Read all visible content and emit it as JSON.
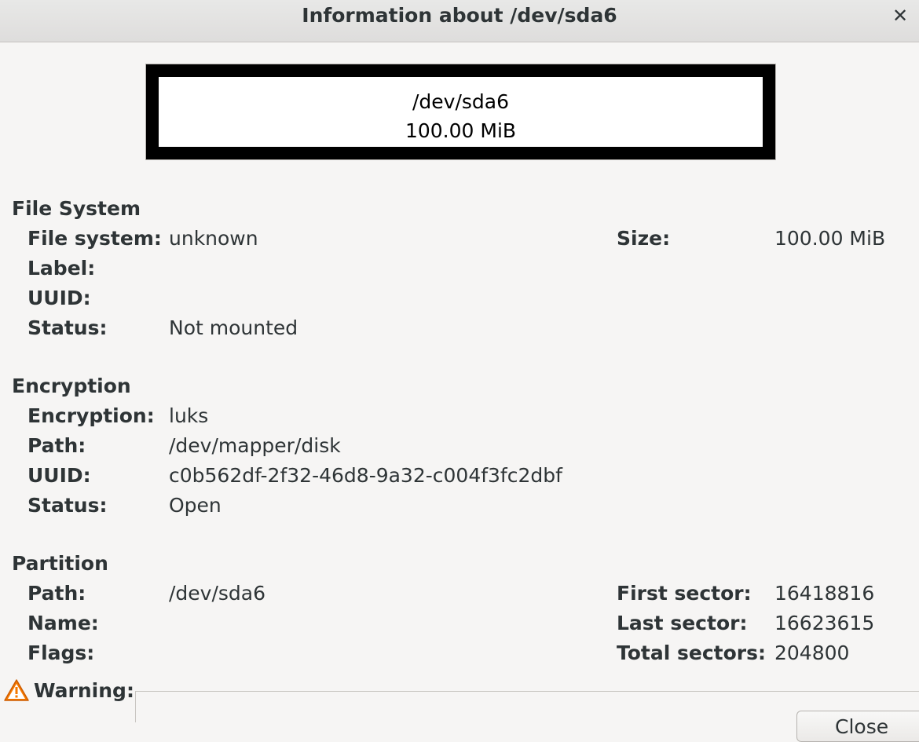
{
  "window": {
    "title": "Information about /dev/sda6",
    "close_glyph": "✕"
  },
  "graphic": {
    "path": "/dev/sda6",
    "size": "100.00 MiB"
  },
  "filesystem": {
    "heading": "File System",
    "fs_label": "File system:",
    "fs_value": "unknown",
    "size_label": "Size:",
    "size_value": "100.00 MiB",
    "label_label": "Label:",
    "label_value": "",
    "uuid_label": "UUID:",
    "uuid_value": "",
    "status_label": "Status:",
    "status_value": "Not mounted"
  },
  "encryption": {
    "heading": "Encryption",
    "enc_label": "Encryption:",
    "enc_value": "luks",
    "path_label": "Path:",
    "path_value": "/dev/mapper/disk",
    "uuid_label": "UUID:",
    "uuid_value": "c0b562df-2f32-46d8-9a32-c004f3fc2dbf",
    "status_label": "Status:",
    "status_value": "Open"
  },
  "partition": {
    "heading": "Partition",
    "path_label": "Path:",
    "path_value": "/dev/sda6",
    "name_label": "Name:",
    "name_value": "",
    "flags_label": "Flags:",
    "flags_value": "",
    "first_label": "First sector:",
    "first_value": "16418816",
    "last_label": "Last sector:",
    "last_value": "16623615",
    "total_label": "Total sectors:",
    "total_value": "204800"
  },
  "warning": {
    "label": "Warning:",
    "icon": "warning-triangle-icon"
  },
  "buttons": {
    "close_label": "Close"
  },
  "colors": {
    "warning_orange": "#f57900",
    "background": "#f6f5f4",
    "text": "#2e3436"
  }
}
